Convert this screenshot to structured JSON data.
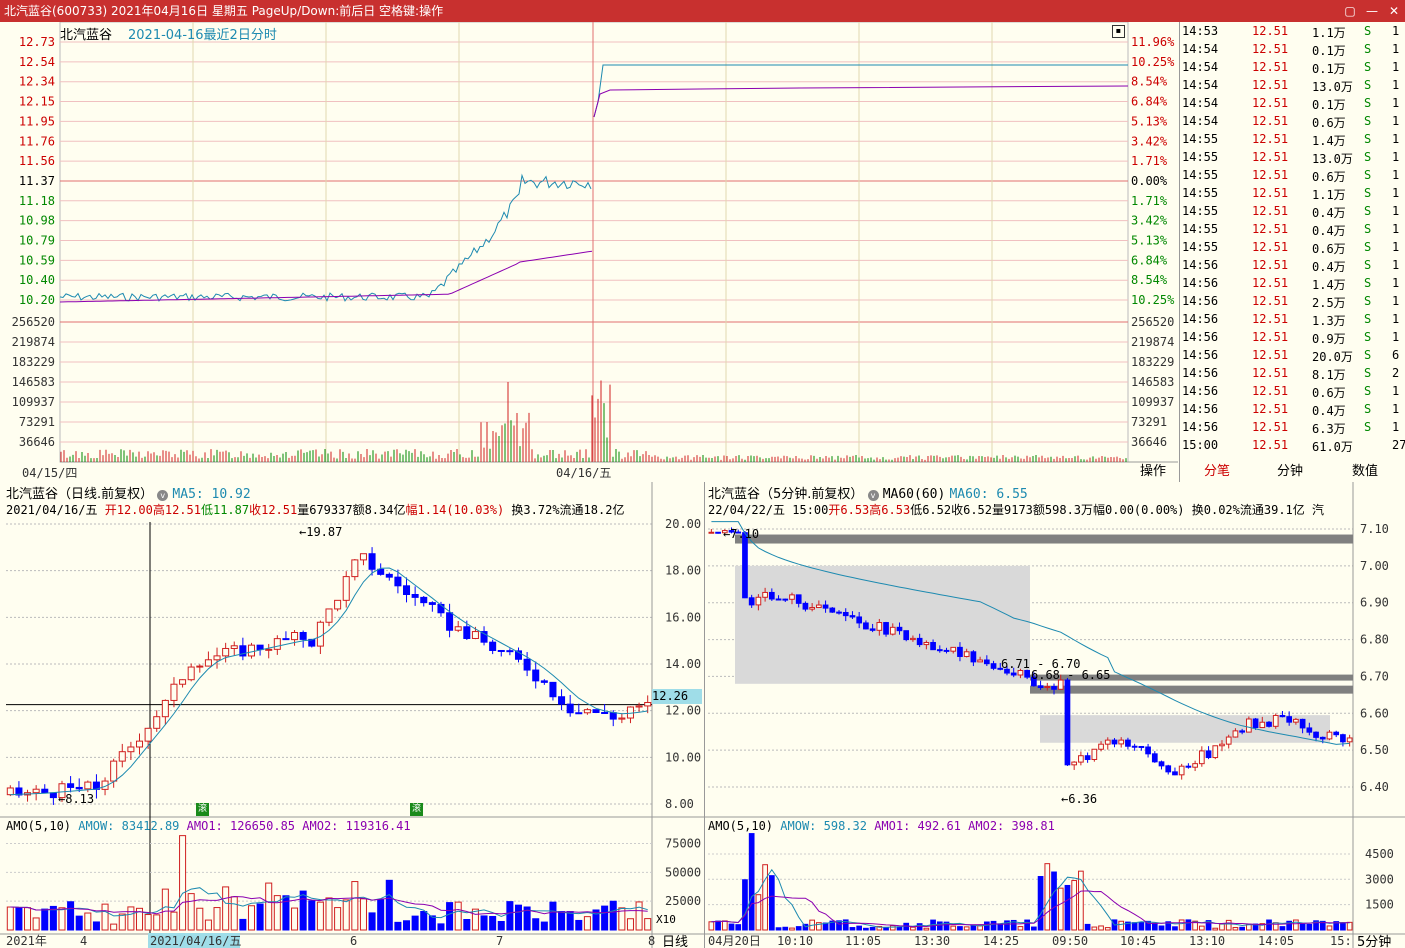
{
  "window": {
    "title": "北汽蓝谷(600733) 2021年04月16日 星期五 PageUp/Down:前后日 空格键:操作",
    "buttons": [
      "▢",
      "—",
      "✕"
    ]
  },
  "intraday": {
    "stock_name": "北汽蓝谷",
    "caption": "2021-04-16最近2日分时",
    "price_ticks": [
      "12.73",
      "12.54",
      "12.34",
      "12.15",
      "11.95",
      "11.76",
      "11.56",
      "11.37",
      "11.18",
      "10.98",
      "10.79",
      "10.59",
      "10.40",
      "10.20"
    ],
    "pct_ticks": [
      "11.96%",
      "10.25%",
      "8.54%",
      "6.84%",
      "5.13%",
      "3.42%",
      "1.71%",
      "0.00%",
      "1.71%",
      "3.42%",
      "5.13%",
      "6.84%",
      "8.54%",
      "10.25%"
    ],
    "volume_ticks": [
      "256520",
      "219874",
      "183229",
      "146583",
      "109937",
      "73291",
      "36646"
    ],
    "date_labels": [
      "04/15/四",
      "04/16/五"
    ],
    "expand_icon": "square-icon"
  },
  "ticks_panel": {
    "rows": [
      {
        "time": "14:53",
        "price": "12.51",
        "vol": "1.1万",
        "side": "S",
        "n": "1"
      },
      {
        "time": "14:54",
        "price": "12.51",
        "vol": "0.1万",
        "side": "S",
        "n": "1"
      },
      {
        "time": "14:54",
        "price": "12.51",
        "vol": "0.1万",
        "side": "S",
        "n": "1"
      },
      {
        "time": "14:54",
        "price": "12.51",
        "vol": "13.0万",
        "side": "S",
        "n": "1"
      },
      {
        "time": "14:54",
        "price": "12.51",
        "vol": "0.1万",
        "side": "S",
        "n": "1"
      },
      {
        "time": "14:54",
        "price": "12.51",
        "vol": "0.6万",
        "side": "S",
        "n": "1"
      },
      {
        "time": "14:55",
        "price": "12.51",
        "vol": "1.4万",
        "side": "S",
        "n": "1"
      },
      {
        "time": "14:55",
        "price": "12.51",
        "vol": "13.0万",
        "side": "S",
        "n": "1"
      },
      {
        "time": "14:55",
        "price": "12.51",
        "vol": "0.6万",
        "side": "S",
        "n": "1"
      },
      {
        "time": "14:55",
        "price": "12.51",
        "vol": "1.1万",
        "side": "S",
        "n": "1"
      },
      {
        "time": "14:55",
        "price": "12.51",
        "vol": "0.4万",
        "side": "S",
        "n": "1"
      },
      {
        "time": "14:55",
        "price": "12.51",
        "vol": "0.4万",
        "side": "S",
        "n": "1"
      },
      {
        "time": "14:55",
        "price": "12.51",
        "vol": "0.6万",
        "side": "S",
        "n": "1"
      },
      {
        "time": "14:56",
        "price": "12.51",
        "vol": "0.4万",
        "side": "S",
        "n": "1"
      },
      {
        "time": "14:56",
        "price": "12.51",
        "vol": "1.4万",
        "side": "S",
        "n": "1"
      },
      {
        "time": "14:56",
        "price": "12.51",
        "vol": "2.5万",
        "side": "S",
        "n": "1"
      },
      {
        "time": "14:56",
        "price": "12.51",
        "vol": "1.3万",
        "side": "S",
        "n": "1"
      },
      {
        "time": "14:56",
        "price": "12.51",
        "vol": "0.9万",
        "side": "S",
        "n": "1"
      },
      {
        "time": "14:56",
        "price": "12.51",
        "vol": "20.0万",
        "side": "S",
        "n": "6"
      },
      {
        "time": "14:56",
        "price": "12.51",
        "vol": "8.1万",
        "side": "S",
        "n": "2"
      },
      {
        "time": "14:56",
        "price": "12.51",
        "vol": "0.6万",
        "side": "S",
        "n": "1"
      },
      {
        "time": "14:56",
        "price": "12.51",
        "vol": "0.4万",
        "side": "S",
        "n": "1"
      },
      {
        "time": "14:56",
        "price": "12.51",
        "vol": "6.3万",
        "side": "S",
        "n": "1"
      },
      {
        "time": "15:00",
        "price": "12.51",
        "vol": "61.0万",
        "side": "",
        "n": "27"
      }
    ],
    "tabs": [
      "操作",
      "分笔",
      "分钟",
      "数值"
    ]
  },
  "daily": {
    "header_name": "北汽蓝谷（日线.前复权）",
    "ma_label": "MA5: 10.92",
    "info_date": "2021/04/16/五",
    "open": "开12.00",
    "high": "高12.51",
    "low": "低11.87",
    "close": "收12.51",
    "volume": "量679337",
    "amount": "额8.34亿",
    "change": "幅1.14(10.03%)",
    "turnover": "换3.72%",
    "float_cap": "流通18.2亿",
    "price_ticks": [
      "20.00",
      "18.00",
      "16.00",
      "14.00",
      "12.00",
      "10.00",
      "8.00"
    ],
    "crosshair_price": "12.26",
    "high_mark": "19.87",
    "low_mark": "8.13",
    "badge": "滚",
    "amo_label": "AMO(5,10)",
    "amow": "AMOW: 83412.89",
    "amo1": "AMO1: 126650.85",
    "amo2": "AMO2: 119316.41",
    "amo_ticks": [
      "75000",
      "50000",
      "25000"
    ],
    "amo_unit": "X10",
    "date_axis": [
      "2021年",
      "4",
      "2021/04/16/五",
      "6",
      "7",
      "8"
    ],
    "period_label": "日线"
  },
  "five_min": {
    "header_name": "北汽蓝谷（5分钟.前复权）",
    "ma60_label": "MA60(60)",
    "ma60_value": "MA60: 6.55",
    "info": "22/04/22/五  15:00",
    "open": "开6.53",
    "high": "高6.53",
    "low": "低6.52",
    "close": "收6.52",
    "volume": "量9173",
    "amount": "额598.3万",
    "change": "幅0.00(0.00%)",
    "turnover": "换0.02%",
    "float_cap": "流通39.1亿",
    "extra": "汽",
    "price_ticks": [
      "7.10",
      "7.00",
      "6.90",
      "6.80",
      "6.70",
      "6.60",
      "6.50",
      "6.40"
    ],
    "mark_top": "7.10",
    "mark_a": "6.71 - 6.70",
    "mark_b": "6.68 - 6.65",
    "mark_low": "6.36",
    "amo_label": "AMO(5,10)",
    "amow": "AMOW: 598.32",
    "amo1": "AMO1: 492.61",
    "amo2": "AMO2: 398.81",
    "amo_ticks": [
      "4500",
      "3000",
      "1500"
    ],
    "date_axis": [
      "04月20日",
      "10:10",
      "11:05",
      "13:30",
      "14:25",
      "09:50",
      "10:45",
      "13:10",
      "14:05",
      "15:"
    ],
    "period_label": "5分钟"
  },
  "colors": {
    "up": "#d02020",
    "down": "#0000ff",
    "price_line": "#1d8ab0",
    "avg_line": "#8b00b0",
    "title_bg": "#c8302f"
  }
}
